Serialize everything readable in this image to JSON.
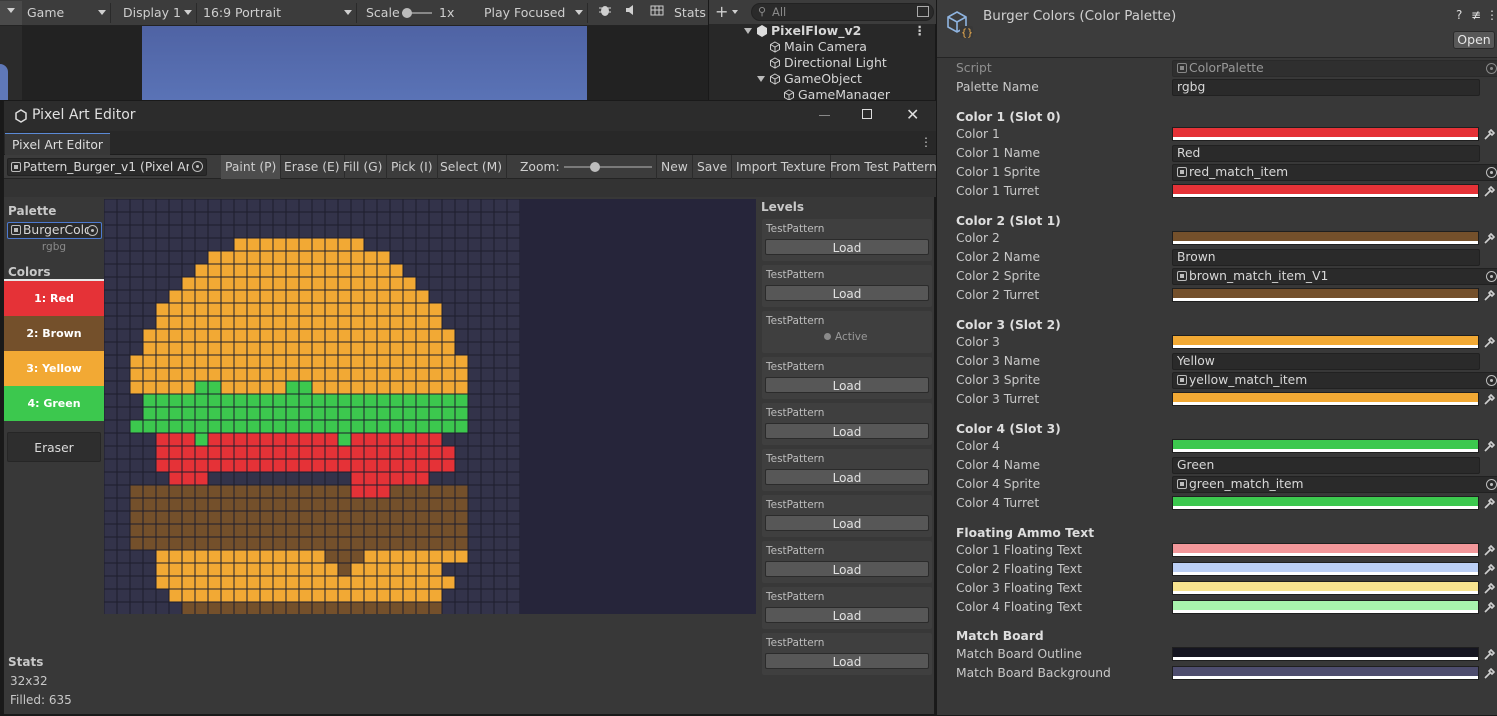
{
  "gamebar": {
    "view": "Game",
    "display": "Display 1",
    "aspect": "16:9 Portrait",
    "scale_label": "Scale",
    "scale_value": "1x",
    "play_mode": "Play Focused",
    "stats": "Stats"
  },
  "hierarchy": {
    "search_placeholder": "All",
    "scene": "PixelFlow_v2",
    "items": [
      "Main Camera",
      "Directional Light",
      "GameObject",
      "GameManager"
    ]
  },
  "inspector": {
    "title": "Burger Colors (Color Palette)",
    "open_button": "Open",
    "script_label": "Script",
    "script_value": "ColorPalette",
    "palette_name_label": "Palette Name",
    "palette_name_value": "rgbg",
    "slots": [
      {
        "header": "Color 1 (Slot 0)",
        "color_label": "Color 1",
        "color": "#e53237",
        "name_label": "Color 1 Name",
        "name": "Red",
        "sprite_label": "Color 1 Sprite",
        "sprite": "red_match_item",
        "turret_label": "Color 1 Turret",
        "turret": "#e53237"
      },
      {
        "header": "Color 2 (Slot 1)",
        "color_label": "Color 2",
        "color": "#74502b",
        "name_label": "Color 2 Name",
        "name": "Brown",
        "sprite_label": "Color 2 Sprite",
        "sprite": "brown_match_item_V1",
        "turret_label": "Color 2 Turret",
        "turret": "#74502b"
      },
      {
        "header": "Color 3 (Slot 2)",
        "color_label": "Color 3",
        "color": "#f2a934",
        "name_label": "Color 3 Name",
        "name": "Yellow",
        "sprite_label": "Color 3 Sprite",
        "sprite": "yellow_match_item",
        "turret_label": "Color 3 Turret",
        "turret": "#f2a934"
      },
      {
        "header": "Color 4 (Slot 3)",
        "color_label": "Color 4",
        "color": "#3cc84e",
        "name_label": "Color 4 Name",
        "name": "Green",
        "sprite_label": "Color 4 Sprite",
        "sprite": "green_match_item",
        "turret_label": "Color 4 Turret",
        "turret": "#3cc84e"
      }
    ],
    "floating_header": "Floating Ammo Text",
    "floating": [
      {
        "label": "Color 1 Floating Text",
        "color": "#f2979a"
      },
      {
        "label": "Color 2 Floating Text",
        "color": "#bcd0f6"
      },
      {
        "label": "Color 3 Floating Text",
        "color": "#f8e48f"
      },
      {
        "label": "Color 4 Floating Text",
        "color": "#a8f4ad"
      }
    ],
    "board_header": "Match Board",
    "board": [
      {
        "label": "Match Board Outline",
        "color": "#151520"
      },
      {
        "label": "Match Board Background",
        "color": "#4e4d6e"
      }
    ]
  },
  "editor": {
    "window_title": "Pixel Art Editor",
    "tab": "Pixel Art Editor",
    "pattern_field": "Pattern_Burger_v1 (Pixel Art L",
    "tools": [
      "Paint (P)",
      "Erase (E)",
      "Fill (G)",
      "Pick (I)",
      "Select (M)"
    ],
    "zoom_label": "Zoom:",
    "actions": [
      "New",
      "Save",
      "Import Texture",
      "From Test Pattern"
    ],
    "palette_header": "Palette",
    "palette_field": "BurgerColo",
    "palette_sub": "rgbg",
    "colors_header": "Colors",
    "colors": [
      {
        "label": "1: Red",
        "color": "#e53237"
      },
      {
        "label": "2: Brown",
        "color": "#74502b"
      },
      {
        "label": "3: Yellow",
        "color": "#f2a934"
      },
      {
        "label": "4: Green",
        "color": "#3cc84e"
      }
    ],
    "eraser": "Eraser",
    "stats_header": "Stats",
    "stats_size": "32x32",
    "stats_filled": "Filled: 635",
    "levels_header": "Levels",
    "levels": [
      {
        "name": "TestPattern",
        "button": "Load"
      },
      {
        "name": "TestPattern",
        "button": "Load"
      },
      {
        "name": "TestPattern",
        "status": "Active"
      },
      {
        "name": "TestPattern",
        "button": "Load"
      },
      {
        "name": "TestPattern",
        "button": "Load"
      },
      {
        "name": "TestPattern",
        "button": "Load"
      },
      {
        "name": "TestPattern",
        "button": "Load"
      },
      {
        "name": "TestPattern",
        "button": "Load"
      },
      {
        "name": "TestPattern",
        "button": "Load"
      },
      {
        "name": "TestPattern",
        "button": "Load"
      }
    ],
    "grid": {
      "cols": 32,
      "rows": 32,
      "bg": "#33334a",
      "line": "#1e1e2c",
      "palette": {
        "1": "#e53237",
        "2": "#74502b",
        "3": "#f2a934",
        "4": "#3cc84e"
      },
      "rows_data": [
        "................................",
        "................................",
        "................................",
        "..........3333333333............",
        "........33333333333333..........",
        ".......3333333333333333.........",
        "......333333333333333333........",
        ".....33333333333333333333.......",
        "....3333333333333333333333......",
        "....3333333333333333333333......",
        "...333333333333333333333333.....",
        "...333333333333333333333333.....",
        "..33333333333333333333333333....",
        "..33333333333333333333333333....",
        "..33333443333344333333333333....",
        "...4444444444444444444444444....",
        "...4444444444444444444444444....",
        "..44444444444444444444444444....",
        "....1114111111111141111111......",
        "....11111111111111111111111.....",
        "....11111111111111111111111.....",
        ".....111...........111111.......",
        "..22222222222222222111222222....",
        "..22222222222222222222222222....",
        "..22222222222222222222222222....",
        "..22222222222222222222222222....",
        "..22222222222222222222222222....",
        "....333333333333322233333333....",
        "....3333333333333323333333......",
        "....33333333333333333333333.....",
        ".....333333333333333333333......",
        "......22222222222222222222......"
      ]
    }
  }
}
